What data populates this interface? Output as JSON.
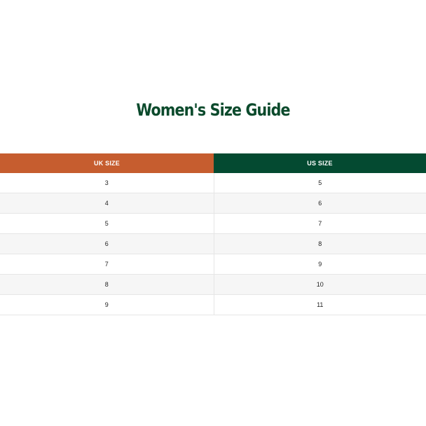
{
  "title": "Women's Size Guide",
  "columns": {
    "uk": "UK SIZE",
    "us": "US SIZE"
  },
  "rows": [
    {
      "uk": "3",
      "us": "5"
    },
    {
      "uk": "4",
      "us": "6"
    },
    {
      "uk": "5",
      "us": "7"
    },
    {
      "uk": "6",
      "us": "8"
    },
    {
      "uk": "7",
      "us": "9"
    },
    {
      "uk": "8",
      "us": "10"
    },
    {
      "uk": "9",
      "us": "11"
    }
  ],
  "colors": {
    "title": "#0b4a2c",
    "uk_header": "#c65d2f",
    "us_header": "#044a31",
    "alt_row": "#f6f6f6"
  }
}
